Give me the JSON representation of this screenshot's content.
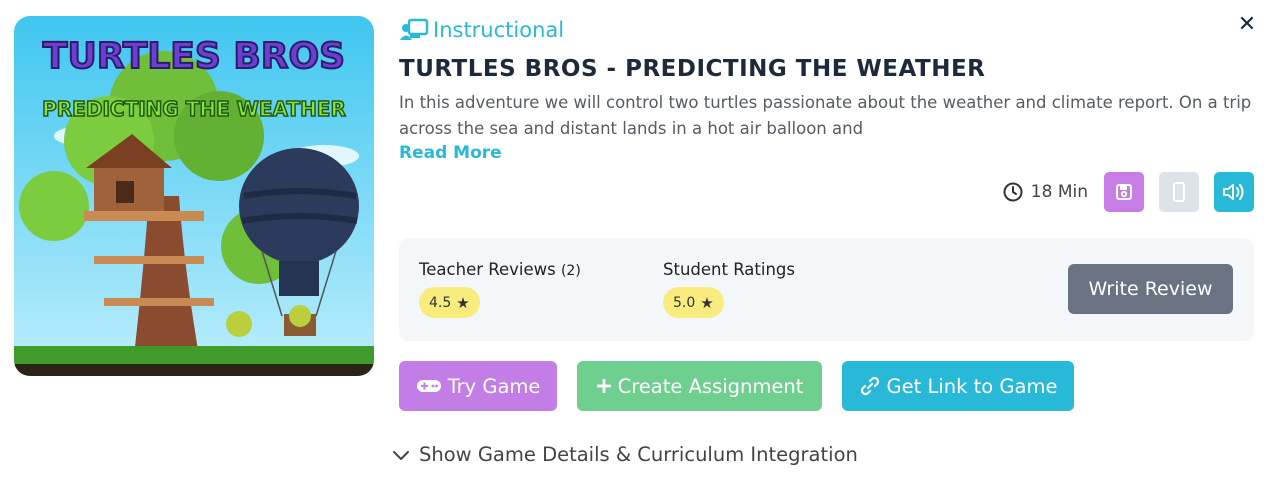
{
  "game": {
    "thumbnail": {
      "alt": "Turtles Bros Predicting the Weather game cover",
      "line1": "TURTLES BROS",
      "line2": "PREDICTING THE WEATHER"
    },
    "category": "Instructional",
    "title": "TURTLES BROS - PREDICTING THE WEATHER",
    "description": "In this adventure we will control two turtles passionate about the weather and climate report. On a trip across the sea and distant lands in a hot air balloon and",
    "read_more_label": "Read More",
    "duration": "18 Min"
  },
  "icons": {
    "category": "teacher-board-icon",
    "duration": "clock-icon",
    "save": "save-icon",
    "mobile": "mobile-icon",
    "audio": "audio-icon",
    "close": "close-icon",
    "try": "gamepad-icon",
    "create": "plus-icon",
    "link": "link-icon",
    "details": "chevron-down-icon",
    "star": "star-icon"
  },
  "reviews": {
    "teacher_label": "Teacher Reviews",
    "teacher_count": "(2)",
    "teacher_rating": "4.5",
    "student_label": "Student Ratings",
    "student_rating": "5.0",
    "write_review_label": "Write Review"
  },
  "actions": {
    "try_label": "Try Game",
    "create_label": "Create Assignment",
    "link_label": "Get Link to Game"
  },
  "details_toggle_label": "Show Game Details & Curriculum Integration",
  "colors": {
    "accent": "#29b9d8",
    "try": "#c27ee6",
    "create": "#6fcf8e",
    "write_review": "#6b7281",
    "badge": "#f9ec7f",
    "title": "#1e2a3b"
  }
}
